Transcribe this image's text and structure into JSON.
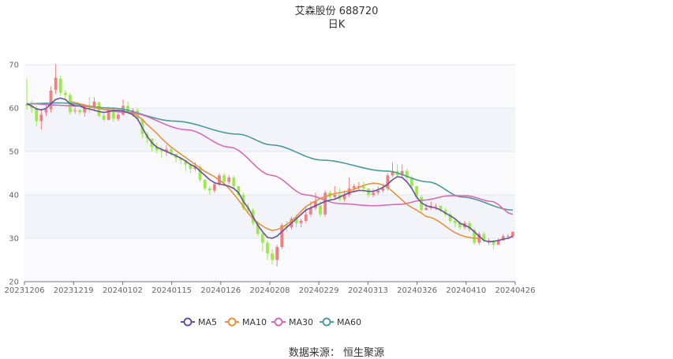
{
  "header": {
    "title": "艾森股份 688720",
    "subtitle": "日K"
  },
  "source_label": "数据来源：  恒生聚源",
  "chart_data": {
    "type": "candlestick",
    "yticks": [
      20,
      30,
      40,
      50,
      60,
      70
    ],
    "ylim": [
      20,
      70
    ],
    "xticks": [
      "20231206",
      "20231219",
      "20240102",
      "20240115",
      "20240126",
      "20240208",
      "20240229",
      "20240313",
      "20240326",
      "20240410",
      "20240426"
    ],
    "colors": {
      "up": "#f08080",
      "down": "#9be94d",
      "ma5": "#6a4fa0",
      "ma10": "#e8913c",
      "ma30": "#d86bb3",
      "ma60": "#4a9b9b"
    },
    "legend": [
      "MA5",
      "MA10",
      "MA30",
      "MA60"
    ],
    "candles": [
      [
        61.0,
        60.5,
        66.8,
        59.6
      ],
      [
        60.5,
        60.0,
        61.8,
        58.9
      ],
      [
        60.0,
        57.0,
        60.5,
        55.8
      ],
      [
        57.0,
        58.5,
        59.7,
        55.0
      ],
      [
        59.0,
        59.7,
        61.3,
        58.2
      ],
      [
        59.7,
        64.0,
        65.0,
        59.0
      ],
      [
        64.2,
        67.0,
        70.0,
        63.2
      ],
      [
        66.8,
        63.5,
        67.5,
        62.8
      ],
      [
        63.5,
        63.0,
        64.2,
        61.8
      ],
      [
        63.0,
        59.0,
        63.5,
        58.5
      ],
      [
        59.5,
        59.5,
        60.2,
        58.7
      ],
      [
        59.5,
        59.0,
        59.8,
        58.5
      ],
      [
        59.0,
        60.5,
        61.0,
        58.0
      ],
      [
        60.5,
        60.0,
        62.5,
        59.0
      ],
      [
        60.0,
        61.5,
        62.5,
        59.5
      ],
      [
        61.3,
        58.2,
        61.5,
        57.9
      ],
      [
        58.3,
        57.3,
        59.0,
        57.0
      ],
      [
        57.3,
        59.5,
        60.3,
        57.1
      ],
      [
        59.5,
        57.5,
        60.0,
        56.8
      ],
      [
        57.5,
        58.5,
        59.5,
        57.0
      ],
      [
        58.5,
        60.5,
        62.0,
        58.2
      ],
      [
        60.5,
        59.0,
        61.5,
        58.5
      ],
      [
        59.0,
        59.5,
        60.0,
        58.0
      ],
      [
        59.5,
        57.5,
        60.0,
        57.0
      ],
      [
        57.5,
        54.0,
        57.5,
        53.0
      ],
      [
        54.0,
        53.0,
        54.5,
        52.0
      ],
      [
        53.0,
        51.0,
        53.0,
        50.0
      ],
      [
        51.0,
        50.3,
        52.0,
        49.5
      ],
      [
        50.3,
        50.0,
        51.0,
        48.5
      ],
      [
        50.0,
        50.5,
        51.5,
        49.0
      ],
      [
        50.5,
        49.5,
        51.0,
        49.0
      ],
      [
        49.5,
        48.5,
        49.5,
        47.5
      ],
      [
        48.5,
        48.0,
        48.5,
        47.0
      ],
      [
        48.0,
        47.0,
        48.0,
        45.5
      ],
      [
        47.0,
        46.0,
        47.0,
        45.0
      ],
      [
        46.0,
        46.5,
        47.5,
        45.5
      ],
      [
        46.5,
        43.5,
        47.0,
        43.0
      ],
      [
        43.5,
        41.5,
        43.5,
        41.0
      ],
      [
        41.5,
        41.0,
        42.0,
        40.0
      ],
      [
        41.0,
        42.5,
        43.0,
        40.5
      ],
      [
        42.5,
        44.5,
        45.0,
        42.0
      ],
      [
        44.5,
        43.0,
        45.0,
        42.0
      ],
      [
        43.0,
        44.0,
        44.5,
        42.5
      ],
      [
        44.0,
        42.0,
        44.5,
        41.5
      ],
      [
        42.0,
        40.0,
        42.0,
        39.5
      ],
      [
        40.0,
        37.0,
        40.5,
        36.5
      ],
      [
        37.0,
        36.5,
        38.0,
        35.5
      ],
      [
        36.5,
        33.5,
        37.0,
        33.0
      ],
      [
        33.5,
        31.0,
        34.0,
        30.5
      ],
      [
        31.0,
        29.0,
        31.5,
        27.0
      ],
      [
        29.0,
        26.5,
        29.5,
        25.0
      ],
      [
        26.5,
        25.0,
        27.5,
        24.0
      ],
      [
        25.0,
        28.0,
        28.5,
        23.5
      ],
      [
        28.0,
        33.0,
        33.5,
        27.5
      ],
      [
        33.0,
        32.5,
        34.0,
        31.5
      ],
      [
        32.5,
        34.5,
        35.0,
        32.0
      ],
      [
        34.5,
        33.5,
        35.5,
        32.5
      ],
      [
        33.5,
        34.0,
        34.5,
        32.5
      ],
      [
        34.0,
        35.5,
        37.5,
        33.5
      ],
      [
        35.5,
        37.0,
        38.5,
        35.0
      ],
      [
        37.0,
        38.5,
        40.5,
        36.5
      ],
      [
        37.5,
        35.5,
        38.5,
        35.0
      ],
      [
        35.5,
        40.5,
        41.0,
        35.0
      ],
      [
        40.5,
        39.5,
        41.0,
        38.5
      ],
      [
        39.5,
        40.0,
        42.0,
        39.0
      ],
      [
        40.0,
        39.0,
        41.5,
        38.5
      ],
      [
        39.0,
        40.0,
        41.0,
        38.5
      ],
      [
        40.0,
        41.5,
        44.0,
        39.5
      ],
      [
        41.5,
        42.0,
        42.5,
        40.5
      ],
      [
        42.0,
        42.0,
        43.0,
        41.0
      ],
      [
        42.0,
        41.5,
        43.0,
        40.5
      ],
      [
        41.5,
        40.0,
        41.5,
        39.5
      ],
      [
        40.0,
        40.5,
        41.5,
        39.5
      ],
      [
        40.5,
        41.0,
        42.0,
        40.0
      ],
      [
        41.0,
        41.5,
        42.5,
        40.5
      ],
      [
        41.5,
        44.5,
        45.0,
        41.0
      ],
      [
        44.5,
        45.5,
        47.5,
        44.0
      ],
      [
        45.5,
        44.5,
        47.0,
        44.0
      ],
      [
        44.5,
        45.5,
        47.0,
        44.0
      ],
      [
        45.5,
        44.0,
        46.0,
        43.0
      ],
      [
        44.0,
        42.0,
        44.5,
        41.5
      ],
      [
        42.0,
        39.5,
        42.0,
        39.0
      ],
      [
        39.5,
        36.5,
        40.0,
        36.0
      ],
      [
        36.5,
        37.0,
        38.0,
        36.5
      ],
      [
        37.0,
        37.5,
        38.5,
        36.5
      ],
      [
        37.5,
        37.5,
        38.0,
        36.5
      ],
      [
        37.5,
        36.5,
        37.5,
        36.0
      ],
      [
        36.5,
        35.5,
        37.0,
        35.0
      ],
      [
        35.5,
        34.0,
        36.0,
        33.5
      ],
      [
        34.0,
        33.5,
        34.5,
        32.5
      ],
      [
        33.5,
        32.5,
        34.0,
        32.0
      ],
      [
        32.5,
        33.5,
        34.0,
        32.0
      ],
      [
        33.5,
        32.0,
        34.0,
        31.5
      ],
      [
        32.0,
        29.0,
        32.5,
        28.5
      ],
      [
        29.0,
        31.0,
        31.5,
        28.5
      ],
      [
        31.0,
        29.5,
        31.5,
        29.0
      ],
      [
        29.5,
        29.5,
        30.0,
        28.5
      ],
      [
        29.5,
        28.5,
        29.5,
        27.5
      ],
      [
        28.5,
        29.5,
        30.0,
        28.5
      ],
      [
        29.5,
        30.5,
        31.0,
        29.5
      ],
      [
        30.5,
        30.5,
        31.0,
        29.8
      ],
      [
        30.5,
        31.5,
        31.5,
        30.0
      ]
    ],
    "ma5": [
      61.0,
      60.5,
      59.8,
      59.6,
      59.9,
      61.0,
      62.0,
      62.3,
      62.0,
      61.0,
      60.5,
      60.5,
      60.0,
      59.8,
      59.5,
      59.2,
      59.0,
      59.2,
      59.4,
      59.5,
      59.3,
      59.0,
      58.5,
      57.5,
      55.5,
      53.5,
      52.0,
      51.0,
      50.5,
      50.0,
      49.5,
      49.0,
      48.5,
      47.8,
      47.0,
      46.5,
      45.5,
      44.5,
      43.5,
      42.8,
      42.5,
      42.3,
      42.0,
      41.5,
      40.5,
      38.5,
      37.0,
      35.0,
      33.0,
      31.5,
      30.2,
      30.0,
      30.5,
      31.5,
      32.5,
      33.5,
      34.5,
      35.5,
      36.5,
      37.0,
      37.5,
      38.0,
      38.5,
      38.8,
      39.0,
      39.5,
      40.0,
      40.5,
      40.8,
      41.0,
      41.0,
      40.8,
      40.8,
      41.2,
      41.7,
      42.5,
      43.5,
      44.2,
      44.0,
      43.0,
      41.5,
      39.5,
      38.2,
      37.5,
      37.2,
      37.0,
      36.5,
      35.8,
      35.2,
      34.5,
      33.5,
      33.0,
      32.5,
      31.5,
      30.5,
      29.5,
      29.2,
      29.3,
      29.5,
      29.8,
      30.0,
      30.5
    ],
    "ma10": [
      null,
      null,
      null,
      null,
      null,
      null,
      null,
      null,
      null,
      61.5,
      61.3,
      61.0,
      60.7,
      60.4,
      60.2,
      60.0,
      59.7,
      59.6,
      59.6,
      59.4,
      59.2,
      59.0,
      58.8,
      58.2,
      57.4,
      56.2,
      55.2,
      54.2,
      53.0,
      52.0,
      51.0,
      50.2,
      49.4,
      48.6,
      47.8,
      47.0,
      46.2,
      45.4,
      44.8,
      44.2,
      43.4,
      42.6,
      41.5,
      40.2,
      38.8,
      37.3,
      35.8,
      34.5,
      33.6,
      32.8,
      32.2,
      31.8,
      32.0,
      32.5,
      33.2,
      34.0,
      35.0,
      36.2,
      37.3,
      38.0,
      38.6,
      39.2,
      39.6,
      40.0,
      40.3,
      40.5,
      40.7,
      40.9,
      41.3,
      41.7,
      42.2,
      42.5,
      42.7,
      42.6,
      42.3,
      41.7,
      40.8,
      39.8,
      38.8,
      37.8,
      37.1,
      36.5,
      35.8,
      35.0,
      34.8,
      34.3,
      33.6,
      32.8,
      32.0,
      31.3,
      30.8,
      30.4,
      30.2,
      30.0,
      30.0
    ]
  }
}
